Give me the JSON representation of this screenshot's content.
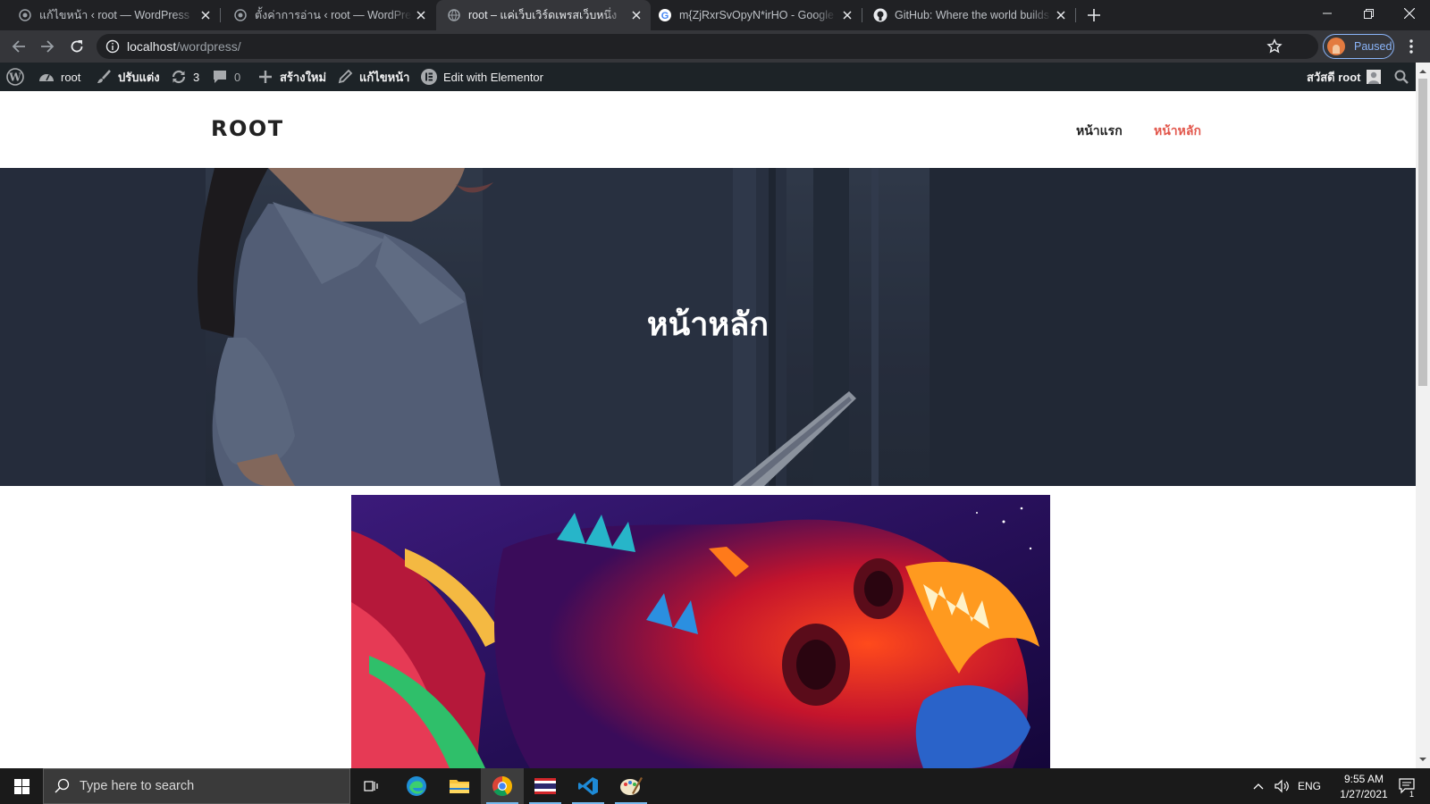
{
  "browser": {
    "tabs": [
      {
        "title": "แก้ไขหน้า ‹ root — WordPress",
        "icon": "wordpress-icon",
        "active": false
      },
      {
        "title": "ตั้งค่าการอ่าน ‹ root — WordPress",
        "icon": "wordpress-icon",
        "active": false
      },
      {
        "title": "root – แค่เว็บเวิร์ดเพรสเว็บหนึ่ง",
        "icon": "globe-icon",
        "active": true
      },
      {
        "title": "m{ZjRxrSvOpyN*irHO - Google S",
        "icon": "google-icon",
        "active": false
      },
      {
        "title": "GitHub: Where the world builds s",
        "icon": "github-icon",
        "active": false
      }
    ],
    "url_host": "localhost",
    "url_path": "/wordpress/",
    "profile_status": "Paused"
  },
  "admin_bar": {
    "site_name": "root",
    "customize": "ปรับแต่ง",
    "updates_count": "3",
    "comments_count": "0",
    "new_label": "สร้างใหม่",
    "edit_page": "แก้ไขหน้า",
    "elementor": "Edit with Elementor",
    "greeting": "สวัสดี root"
  },
  "site": {
    "logo": "ROOT",
    "menu": [
      {
        "label": "หน้าแรก",
        "current": false
      },
      {
        "label": "หน้าหลัก",
        "current": true
      }
    ],
    "hero_title": "หน้าหลัก",
    "accent_color": "#e2574c"
  },
  "taskbar": {
    "search_placeholder": "Type here to search",
    "apps": [
      "task-view-icon",
      "edge-icon",
      "file-explorer-icon",
      "chrome-icon",
      "thai-flag-app-icon",
      "vscode-icon",
      "paint-icon"
    ],
    "language": "ENG",
    "time": "9:55 AM",
    "date": "1/27/2021",
    "notification_count": "1"
  }
}
